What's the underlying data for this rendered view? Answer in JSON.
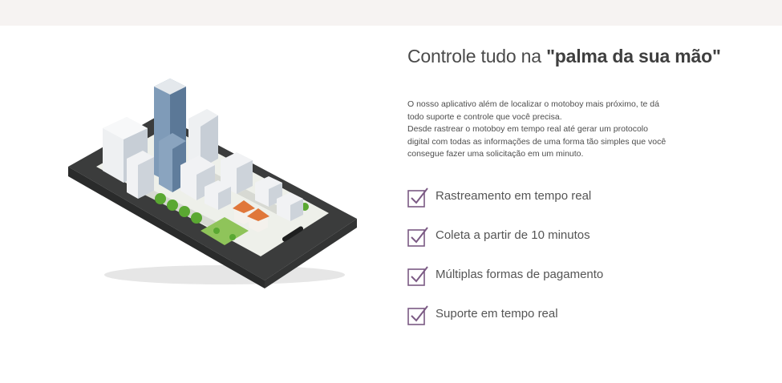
{
  "colors": {
    "top_band": "#f6f3f2",
    "check_accent": "#7b5a84",
    "text": "#555555"
  },
  "heading": {
    "prefix": "Controle tudo na ",
    "emphasis": "\"palma da sua mão\""
  },
  "description": {
    "paragraph_1": "O nosso aplicativo além de localizar o motoboy mais próximo, te dá todo suporte e controle que você precisa.",
    "paragraph_2": "Desde rastrear o motoboy em tempo real até gerar um protocolo digital com todas as informações de uma forma tão simples que você consegue fazer uma solicitação em um minuto."
  },
  "illustration": {
    "icon": "smartphone-city-illustration"
  },
  "features": [
    {
      "icon": "checkbox-checked-icon",
      "label": "Rastreamento em tempo real"
    },
    {
      "icon": "checkbox-checked-icon",
      "label": "Coleta a partir de 10 minutos"
    },
    {
      "icon": "checkbox-checked-icon",
      "label": "Múltiplas formas de pagamento"
    },
    {
      "icon": "checkbox-checked-icon",
      "label": "Suporte em tempo real"
    }
  ]
}
